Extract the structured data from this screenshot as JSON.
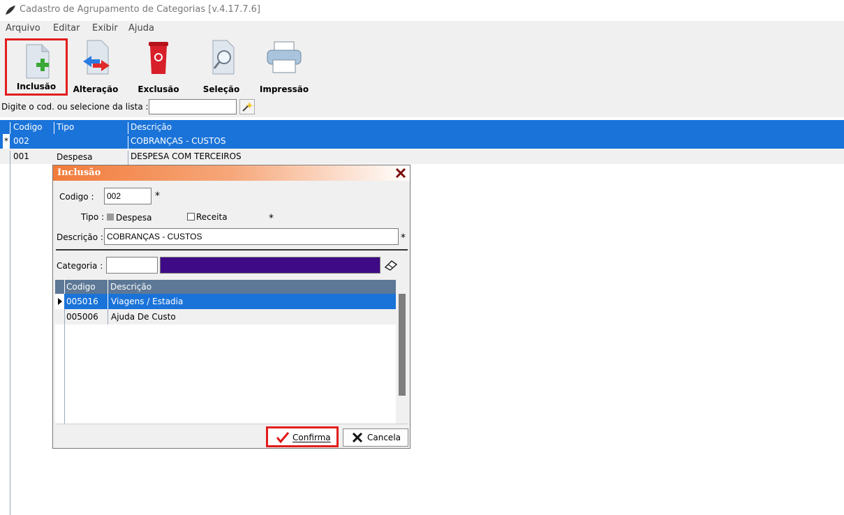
{
  "window": {
    "title": "Cadastro de Agrupamento de Categorias [v.4.17.7.6]"
  },
  "menu": [
    "Arquivo",
    "Editar",
    "Exibir",
    "Ajuda"
  ],
  "toolbar": {
    "inclusao": "Inclusão",
    "alteracao": "Alteração",
    "exclusao": "Exclusão",
    "selecao": "Seleção",
    "impressao": "Impressão"
  },
  "filter": {
    "label": "Digite o cod. ou selecione da lista :",
    "value": ""
  },
  "grid": {
    "headers": [
      "Codigo",
      "Tipo",
      "Descrição"
    ],
    "rows": [
      {
        "marker": "*",
        "codigo": "002",
        "tipo": "",
        "descricao": "COBRANÇAS - CUSTOS"
      },
      {
        "marker": "",
        "codigo": "001",
        "tipo": "Despesa",
        "descricao": "DESPESA COM TERCEIROS"
      }
    ]
  },
  "dialog": {
    "title": "Inclusão",
    "codigo_label": "Codigo :",
    "codigo_value": "002",
    "tipo_label": "Tipo :",
    "despesa_label": "Despesa",
    "receita_label": "Receita",
    "descricao_label": "Descrição :",
    "descricao_value": "COBRANÇAS - CUSTOS",
    "categoria_label": "Categoria :",
    "categoria_value": "",
    "required_mark": "*",
    "categoria_color": "#3f0a85",
    "grid_headers": [
      "Codigo",
      "Descrição"
    ],
    "grid_rows": [
      {
        "codigo": "005016",
        "descricao": "Viagens / Estadia"
      },
      {
        "codigo": "005006",
        "descricao": "Ajuda De Custo"
      }
    ],
    "confirma": "Confirma",
    "cancela": "Cancela"
  }
}
